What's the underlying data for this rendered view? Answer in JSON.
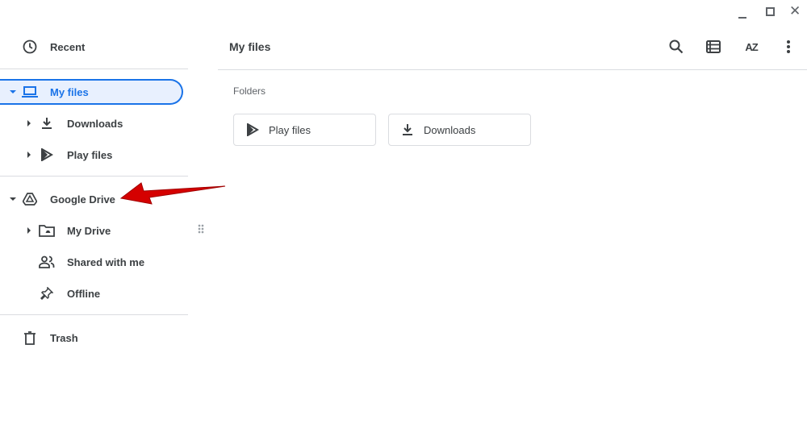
{
  "window": {
    "controls": [
      "minimize",
      "maximize",
      "close"
    ]
  },
  "sidebar": {
    "recent": "Recent",
    "my_files": "My files",
    "downloads": "Downloads",
    "play_files": "Play files",
    "google_drive": "Google Drive",
    "my_drive": "My Drive",
    "shared_with_me": "Shared with me",
    "offline": "Offline",
    "trash": "Trash"
  },
  "header": {
    "title": "My files"
  },
  "toolbar": {
    "search": "search-icon",
    "view": "list-view-icon",
    "sort": "sort-az-icon",
    "more": "more-vert-icon",
    "sort_label": "AZ"
  },
  "main": {
    "section_label": "Folders",
    "folders": [
      {
        "label": "Play files"
      },
      {
        "label": "Downloads"
      }
    ]
  },
  "colors": {
    "accent": "#1a73e8",
    "selected_bg": "#e8f0fe",
    "arrow": "#d50000"
  }
}
